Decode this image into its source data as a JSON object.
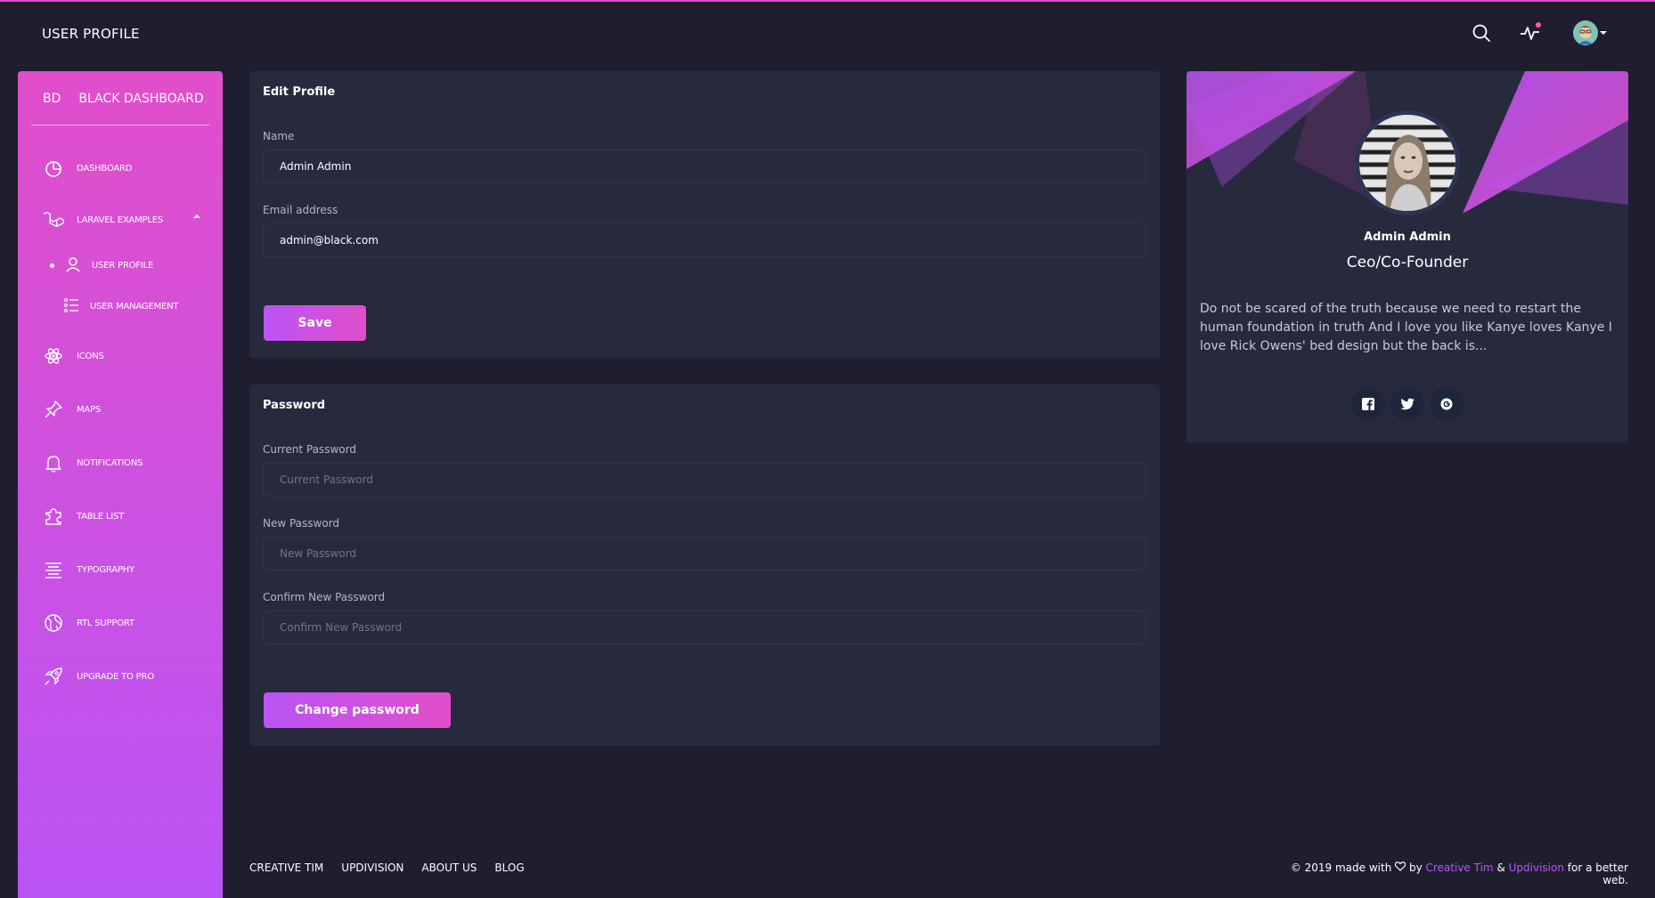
{
  "colors": {
    "background": "#1e1e2f",
    "card": "#27293d",
    "primary": "#e14eca",
    "primary_alt": "#ba54f5",
    "notification": "#fd5d93"
  },
  "header": {
    "title": "USER PROFILE"
  },
  "sidebar": {
    "brand_short": "BD",
    "brand_name": "BLACK DASHBOARD",
    "items": [
      {
        "label": "DASHBOARD",
        "icon": "pie-chart-icon"
      },
      {
        "label": "LARAVEL EXAMPLES",
        "icon": "laravel-icon"
      },
      {
        "label": "ICONS",
        "icon": "atom-icon"
      },
      {
        "label": "MAPS",
        "icon": "pin-icon"
      },
      {
        "label": "NOTIFICATIONS",
        "icon": "bell-icon"
      },
      {
        "label": "TABLE LIST",
        "icon": "puzzle-icon"
      },
      {
        "label": "TYPOGRAPHY",
        "icon": "align-center-icon"
      },
      {
        "label": "RTL SUPPORT",
        "icon": "world-icon"
      },
      {
        "label": "UPGRADE TO PRO",
        "icon": "rocket-icon"
      }
    ],
    "sub_items": [
      {
        "label": "USER PROFILE",
        "icon": "user-icon",
        "active": true
      },
      {
        "label": "USER MANAGEMENT",
        "icon": "list-icon",
        "active": false
      }
    ]
  },
  "edit_profile": {
    "title": "Edit Profile",
    "name_label": "Name",
    "name_value": "Admin Admin",
    "email_label": "Email address",
    "email_value": "admin@black.com",
    "save_label": "Save"
  },
  "password": {
    "title": "Password",
    "current_label": "Current Password",
    "current_placeholder": "Current Password",
    "new_label": "New Password",
    "new_placeholder": "New Password",
    "confirm_label": "Confirm New Password",
    "confirm_placeholder": "Confirm New Password",
    "button_label": "Change password"
  },
  "profile_card": {
    "name": "Admin Admin",
    "role": "Ceo/Co-Founder",
    "description": "Do not be scared of the truth because we need to restart the human foundation in truth And I love you like Kanye loves Kanye I love Rick Owens' bed design but the back is...",
    "social": [
      "facebook-icon",
      "twitter-icon",
      "google-icon"
    ]
  },
  "footer": {
    "links": [
      "CREATIVE TIM",
      "UPDIVISION",
      "ABOUT US",
      "BLOG"
    ],
    "copyright_prefix": "© 2019 made with",
    "by": "by",
    "creative_tim": "Creative Tim",
    "amp": "&",
    "updivision": "Updivision",
    "suffix": "for a better web."
  }
}
